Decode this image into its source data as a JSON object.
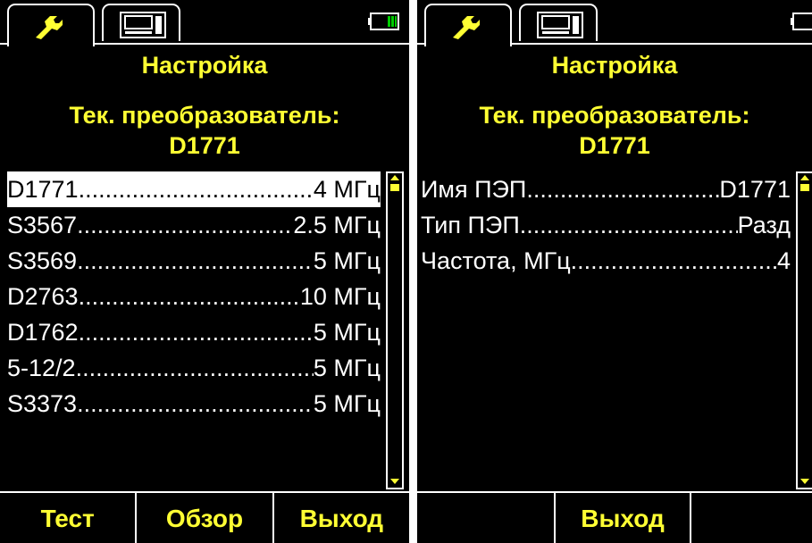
{
  "left": {
    "header": "Настройка",
    "subtitle_line1": "Тек. преобразователь:",
    "subtitle_line2": "D1771",
    "items": [
      {
        "name": "D1771",
        "value": "4 МГц"
      },
      {
        "name": "S3567",
        "value": "2.5 МГц"
      },
      {
        "name": "S3569",
        "value": "5 МГц"
      },
      {
        "name": "D2763",
        "value": "10 МГц"
      },
      {
        "name": "D1762",
        "value": "5 МГц"
      },
      {
        "name": "5-12/2",
        "value": "5 МГц"
      },
      {
        "name": "S3373",
        "value": "5 МГц"
      }
    ],
    "buttons": [
      "Тест",
      "Обзор",
      "Выход"
    ]
  },
  "right": {
    "header": "Настройка",
    "subtitle_line1": "Тек. преобразователь:",
    "subtitle_line2": "D1771",
    "items": [
      {
        "name": "Имя ПЭП",
        "value": "D1771"
      },
      {
        "name": "Тип ПЭП",
        "value": "Разд"
      },
      {
        "name": "Частота, МГц",
        "value": "4"
      }
    ],
    "buttons": [
      "",
      "Выход",
      ""
    ]
  },
  "colors": {
    "accent": "#ffff33",
    "battery": "#00cc00",
    "background": "#000000"
  },
  "icons": {
    "tab1": "wrench-icon",
    "tab2": "meter-icon",
    "status": "battery-icon"
  }
}
